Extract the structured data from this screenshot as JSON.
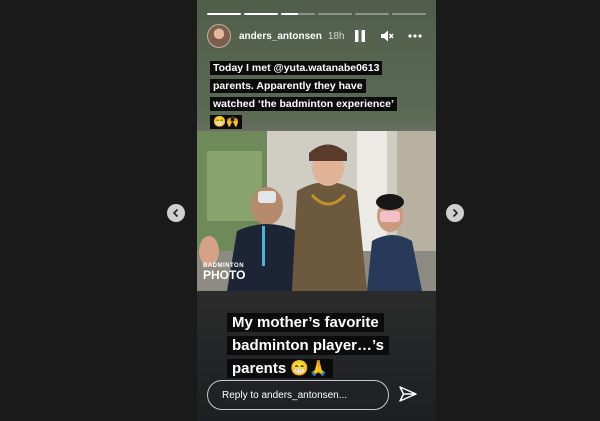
{
  "story": {
    "progress": [
      1,
      1,
      0.5,
      0,
      0,
      0
    ],
    "username": "anders_antonsen",
    "time": "18h",
    "caption": "Today I met @yuta.watanabe0613 parents. Apparently they have watched ‘the badminton experience’ 😁🙌",
    "photo_watermark": [
      "BADMINTON",
      "PHOTO"
    ],
    "big_caption": "My mother’s favorite badminton player…’s parents 😁🙏",
    "reply_placeholder": "Reply to anders_antonsen..."
  },
  "icons": {
    "pause": "pause-icon",
    "mute": "speaker-muted-icon",
    "more": "more-icon",
    "send": "send-icon",
    "prev": "chevron-left-icon",
    "next": "chevron-right-icon"
  }
}
